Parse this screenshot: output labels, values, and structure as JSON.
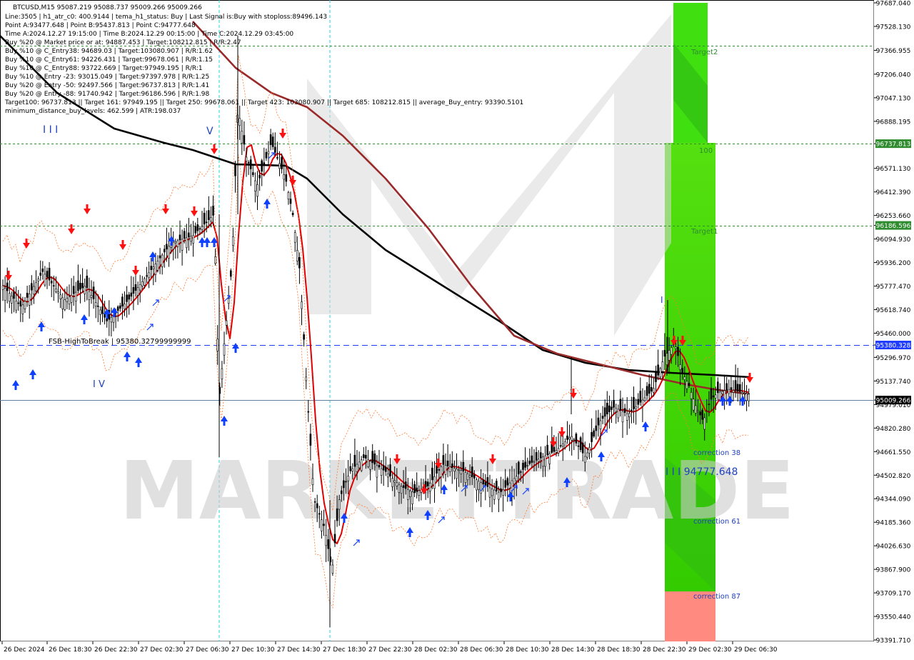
{
  "chart_data": {
    "type": "candlestick",
    "symbol_line": "BTCUSD,M15  95087.219 95088.737 95009.266 95009.266",
    "info_lines": [
      "Line:3505 | h1_atr_c0: 400.9144 | tema_h1_status: Buy | Last Signal is:Buy with stoploss:89496.143",
      "Point A:93477.648 | Point B:95437.813 | Point C:94777.648",
      "Time A:2024.12.27 19:15:00 | Time B:2024.12.29 00:15:00 | Time C:2024.12.29 03:45:00",
      "Buy %20 @ Market price or at: 94887.453 | Target:108212.815 | R/R:2.47",
      "Buy %10 @ C_Entry38: 94689.03 | Target:103080.907 | R/R:1.62",
      "Buy %10 @ C_Entry61: 94226.431 | Target:99678.061 | R/R:1.15",
      "Buy %10 @ C_Entry88: 93722.669 | Target:97949.195 | R/R:1",
      "Buy %10 @ Entry -23: 93015.049 | Target:97397.978 | R/R:1.25",
      "Buy %20 @ Entry -50: 92497.566 | Target:96737.813 | R/R:1.41",
      "Buy %20 @ Entry -88: 91740.942 | Target:96186.596 | R/R:1.98",
      "Target100: 96737.813 || Target 161: 97949.195 || Target 250: 99678.061 || Target 423: 103080.907 || Target 685: 108212.815 || average_Buy_entry: 93390.5101",
      "minimum_distance_buy_levels: 462.599 | ATR:198.037"
    ],
    "y_ticks": [
      "97687.040",
      "97528.130",
      "97366.955",
      "97206.040",
      "97047.130",
      "96888.195",
      "96737.813",
      "96571.130",
      "96412.390",
      "96253.660",
      "96186.596",
      "96094.930",
      "95936.200",
      "95777.470",
      "95618.740",
      "95460.000",
      "95380.328",
      "95296.970",
      "95137.740",
      "95009.266",
      "94979.010",
      "94820.280",
      "94661.550",
      "94502.820",
      "94344.090",
      "94185.360",
      "94026.630",
      "93867.900",
      "93709.170",
      "93550.440",
      "93391.710"
    ],
    "y_tick_values": [
      97687.04,
      97528.13,
      97366.955,
      97206.04,
      97047.13,
      96888.195,
      96737.813,
      96571.13,
      96412.39,
      96253.66,
      96186.596,
      96094.93,
      95936.2,
      95777.47,
      95618.74,
      95460.0,
      95380.328,
      95296.97,
      95137.74,
      95009.266,
      94979.01,
      94820.28,
      94661.55,
      94502.82,
      94344.09,
      94185.36,
      94026.63,
      93867.9,
      93709.17,
      93550.44,
      93391.71
    ],
    "ylim": [
      93391.71,
      97687.04
    ],
    "x_ticks": [
      "26 Dec 2024",
      "26 Dec 18:30",
      "26 Dec 22:30",
      "27 Dec 02:30",
      "27 Dec 06:30",
      "27 Dec 10:30",
      "27 Dec 14:30",
      "27 Dec 18:30",
      "27 Dec 22:30",
      "28 Dec 02:30",
      "28 Dec 06:30",
      "28 Dec 10:30",
      "28 Dec 14:30",
      "28 Dec 18:30",
      "28 Dec 22:30",
      "29 Dec 02:30",
      "29 Dec 06:30"
    ],
    "price_levels": [
      {
        "label": "97397.978",
        "value": 97397.978,
        "color": "#2e8b2e",
        "text": "Target2"
      },
      {
        "label": "96737.813",
        "value": 96737.813,
        "color": "#2e8b2e",
        "text": "100"
      },
      {
        "label": "96186.596",
        "value": 96186.596,
        "color": "#2e8b2e",
        "text": "Target1"
      },
      {
        "label": "95380.328",
        "value": 95380.328,
        "color": "#1e3cff",
        "text": "FSB-HighToBreak | 95380.32799999999"
      },
      {
        "label": "95009.266",
        "value": 95009.266,
        "color": "#000000",
        "text": ""
      }
    ],
    "annotations": {
      "wave_marks": [
        "I I I",
        "V",
        "I V",
        "I"
      ],
      "correction_labels": [
        "correction 38",
        "correction 61",
        "correction 87"
      ],
      "point_c_label": "I I I 94777.648"
    },
    "watermark": "MARKETTRADE",
    "colors": {
      "bull": "#000000",
      "ma_fast": "#e00000",
      "ma_slow": "#9a2a2a",
      "ma_long": "#000000",
      "zone_green": "#33dd00",
      "zone_red": "#ff8080",
      "buy_arrow": "#1040ff",
      "sell_arrow": "#ff1010"
    }
  }
}
